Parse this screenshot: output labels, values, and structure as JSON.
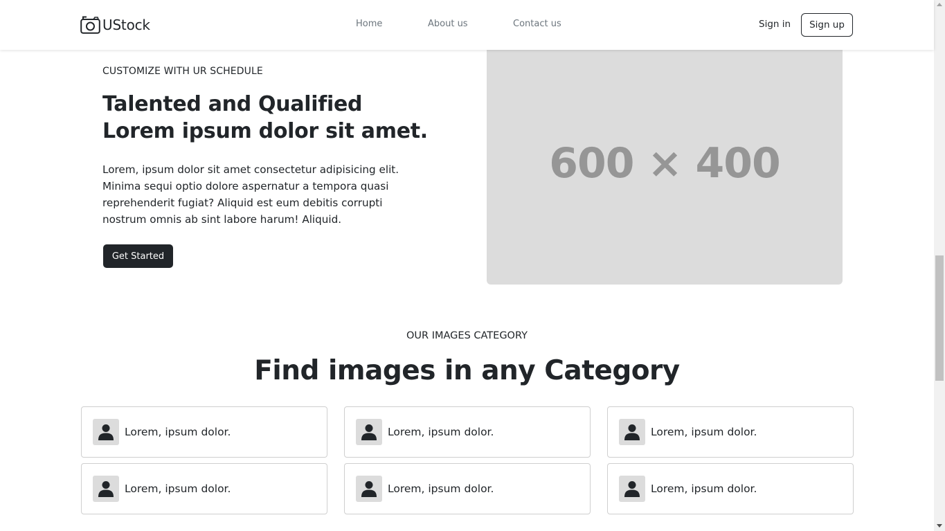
{
  "navbar": {
    "brand": "UStock",
    "brand_icon": "camera-icon",
    "links": [
      "Home",
      "About us",
      "Contact us"
    ],
    "sign_in": "Sign in",
    "sign_up": "Sign up"
  },
  "hero": {
    "eyebrow": "CUSTOMIZE WITH UR SCHEDULE",
    "title_line1": "Talented and Qualified",
    "title_line2": "Lorem ipsum dolor sit amet.",
    "text": "Lorem, ipsum dolor sit amet consectetur adipisicing elit. Minima sequi optio dolore aspernatur a tempora quasi reprehenderit fugiat? Aliquid est eum debitis corrupti nostrum omnis ab sint labore harum! Aliquid.",
    "cta": "Get Started",
    "image_placeholder": "600 × 400"
  },
  "categories": {
    "eyebrow": "OUR IMAGES CATEGORY",
    "title": "Find images in any Category",
    "icon": "user-icon",
    "items": [
      "Lorem, ipsum dolor.",
      "Lorem, ipsum dolor.",
      "Lorem, ipsum dolor.",
      "Lorem, ipsum dolor.",
      "Lorem, ipsum dolor.",
      "Lorem, ipsum dolor."
    ]
  },
  "colors": {
    "text": "#212529",
    "muted": "#6c757d",
    "button_dark": "#212529",
    "placeholder_bg": "#dcdcdc",
    "placeholder_text": "#969696"
  }
}
